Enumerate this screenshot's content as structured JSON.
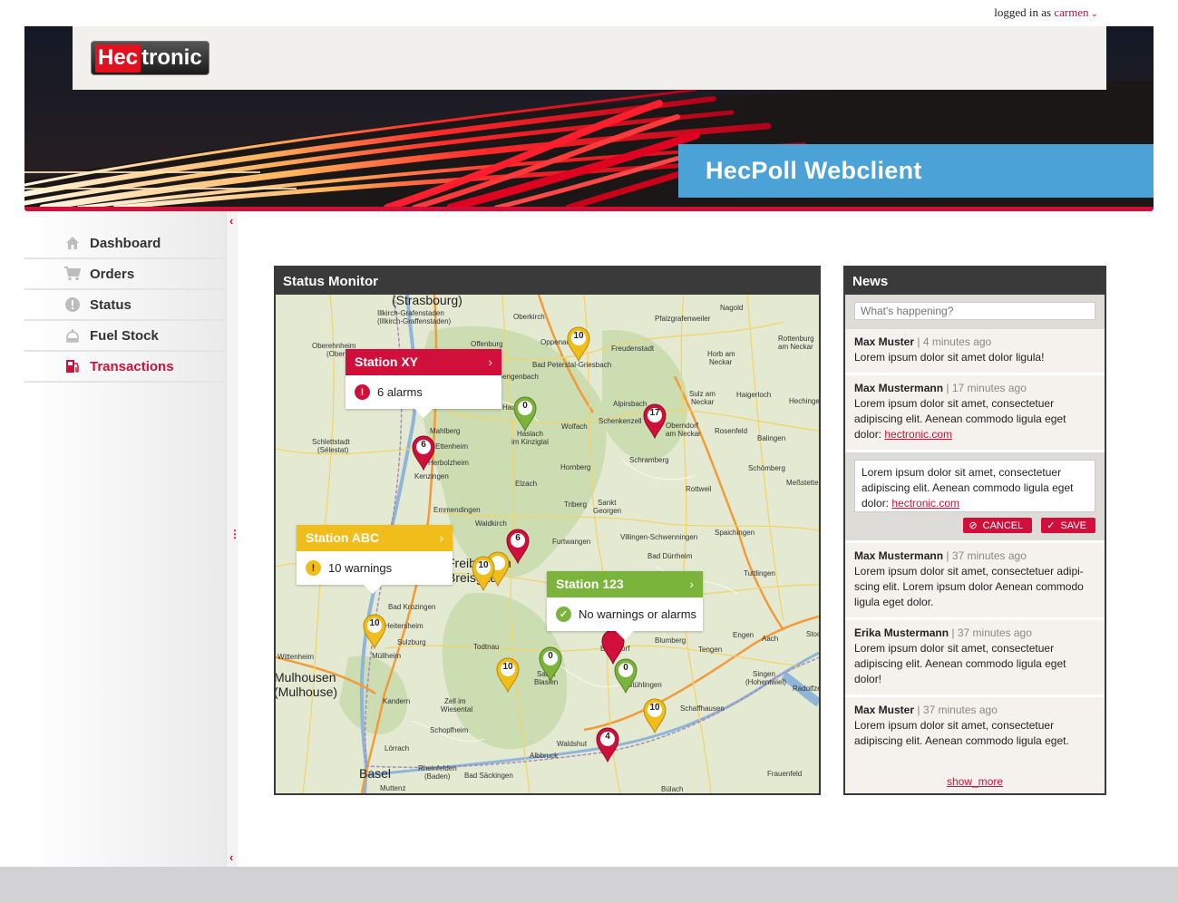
{
  "login": {
    "prefix": "logged in as",
    "user": "carmen"
  },
  "logo": {
    "part1": "Hec",
    "part2": "tronic"
  },
  "app_title": "HecPoll Webclient",
  "nav": [
    {
      "label": "Dashboard",
      "icon": "home-icon",
      "active": false
    },
    {
      "label": "Orders",
      "icon": "cart-icon",
      "active": false
    },
    {
      "label": "Status",
      "icon": "alert-icon",
      "active": false
    },
    {
      "label": "Fuel Stock",
      "icon": "tank-icon",
      "active": false
    },
    {
      "label": "Transactions",
      "icon": "fuel-pump-icon",
      "active": true
    }
  ],
  "status_monitor": {
    "title": "Status Monitor",
    "callouts": [
      {
        "station": "Station XY",
        "message": "6 alarms",
        "color": "#d0103a"
      },
      {
        "station": "Station ABC",
        "message": "10 warnings",
        "color": "#f0bd1b"
      },
      {
        "station": "Station 123",
        "message": "No warnings or alarms",
        "color": "#7ab43a"
      }
    ],
    "pins": [
      "10",
      "0",
      "17",
      "6",
      "6",
      "10",
      "10",
      "10",
      "0",
      "0",
      "10",
      "4"
    ],
    "towns": {
      "strasbourg": "(Strasbourg)",
      "illkirch": "Illkirch-Grafenstaden",
      "illkirch2": "(Illkirch-Graffenstaden)",
      "oberkirch": "Oberkirch",
      "offenburg": "Offenburg",
      "oppenau": "Oppenau",
      "pfalzgrafenweiler": "Pfalzgrafenweiler",
      "nagold": "Nagold",
      "rottenburg": "Rottenburg",
      "rottenburg2": "am Neckar",
      "freudenstadt": "Freudenstadt",
      "horb": "Horb am",
      "horb2": "Neckar",
      "bad_peterstal": "Bad Peterstal-Griesbach",
      "gengenbach": "Gengenbach",
      "alpirsbach": "Alpirsbach",
      "sulz": "Sulz am",
      "sulz2": "Neckar",
      "haigerloch": "Haigerloch",
      "hechingen": "Hechingen",
      "hausach": "Hausach",
      "haslach": "Haslach",
      "haslach2": "im Kinzigtal",
      "wolfach": "Wolfach",
      "schenkenzell": "Schenkenzell",
      "oberndorf": "Oberndorf",
      "oberndorf2": "am Neckar",
      "rosenfeld": "Rosenfeld",
      "balingen": "Balingen",
      "mahlberg": "Mahlberg",
      "ettenheim": "Ettenheim",
      "herbolzheim": "Herbolzheim",
      "kenzingen": "Kenzingen",
      "schlettstadt": "Schlettstadt",
      "schlettstadt2": "(Sélestat)",
      "hornberg": "Hornberg",
      "schramberg": "Schramberg",
      "schomberg": "Schömberg",
      "messstetten": "Meßstetten",
      "elzach": "Elzach",
      "rottweil": "Rottweil",
      "triberg": "Triberg",
      "sankt_georgen": "Sankt",
      "sankt_georgen2": "Georgen",
      "emmendingen": "Emmendingen",
      "waldkirch": "Waldkirch",
      "furtwangen": "Furtwangen",
      "villingen": "Villingen-Schwenningen",
      "spaichingen": "Spaichingen",
      "bad_durrheim": "Bad Dürrheim",
      "tuttlingen": "Tuttlingen",
      "freiburg": "Freiburg im",
      "freiburg2": "Breisgau",
      "bad_krozingen": "Bad Krozingen",
      "heitersheim": "Heitersheim",
      "sulzburg": "Sulzburg",
      "mullheim": "Müllheim",
      "wittenheim": "Wittenheim",
      "todtnau": "Todtnau",
      "blumberg": "Blumberg",
      "engen": "Engen",
      "aach": "Aach",
      "tengen": "Tengen",
      "singen": "Singen",
      "singen2": "(Hohentwiel)",
      "radolfzell": "Radolfzell",
      "mulhouse": "Mulhousen",
      "mulhouse2": "(Mulhouse)",
      "kandern": "Kandern",
      "zell": "Zell im",
      "zell2": "Wiesental",
      "st_blasien": "Sankt",
      "st_blasien2": "Blasien",
      "stuhlingen": "Stühlingen",
      "schaffhausen": "Schaffhausen",
      "schopfheim": "Schopfheim",
      "lorrach": "Lörrach",
      "waldshut": "Waldshut",
      "albbruck": "Albbruck",
      "rheinfelden": "Rheinfelden",
      "rheinfelden2": "(Baden)",
      "bad_sackingen": "Bad Säckingen",
      "basel": "Basel",
      "muttenz": "Muttenz",
      "frauenfeld": "Frauenfeld",
      "bulach": "Bülach",
      "bonndorf": "Bonndorf",
      "oberehnheim": "Oberehnheim",
      "oberehnheim2": "(Obernai)",
      "stock": "Stoc"
    }
  },
  "news": {
    "title": "News",
    "placeholder": "What's happening?",
    "items_top": [
      {
        "author": "Max Muster",
        "meta": "4 minutes ago",
        "text": "Lorem ipsum dolor sit amet dolor ligula!",
        "link": ""
      },
      {
        "author": "Max Mustermann",
        "meta": "17 minutes ago",
        "text": "Lorem ipsum dolor sit amet, consectetuer adipiscing elit. Aenean commodo ligula eget dolor: ",
        "link": "hectronic.com"
      }
    ],
    "edit": {
      "text": "Lorem ipsum dolor sit amet, consectetuer adipiscing elit. Aenean commodo ligula eget dolor: ",
      "link": "hectronic.com",
      "cancel": "CANCEL",
      "save": "SAVE"
    },
    "items_bottom": [
      {
        "author": "Max Mustermann",
        "meta": "37 minutes ago",
        "text": "Lorem ipsum dolor sit amet, consectetuer adipi-scing elit. Lorem ipsum dolor Aenean commodo ligula eget dolor.",
        "link": ""
      },
      {
        "author": "Erika Mustermann",
        "meta": "37 minutes ago",
        "text": "Lorem ipsum dolor sit amet, consectetuer adipiscing elit. Aenean commodo ligula eget dolor!",
        "link": ""
      },
      {
        "author": "Max Muster",
        "meta": "37 minutes ago",
        "text": "Lorem ipsum dolor sit amet, consectetuer adipiscing elit. Aenean commodo ligula eget.",
        "link": ""
      }
    ],
    "show_more": "show_more"
  },
  "colors": {
    "accent": "#d0103a",
    "title_bar": "#4aa2d6",
    "warning": "#f0bd1b",
    "ok": "#7ab43a"
  }
}
